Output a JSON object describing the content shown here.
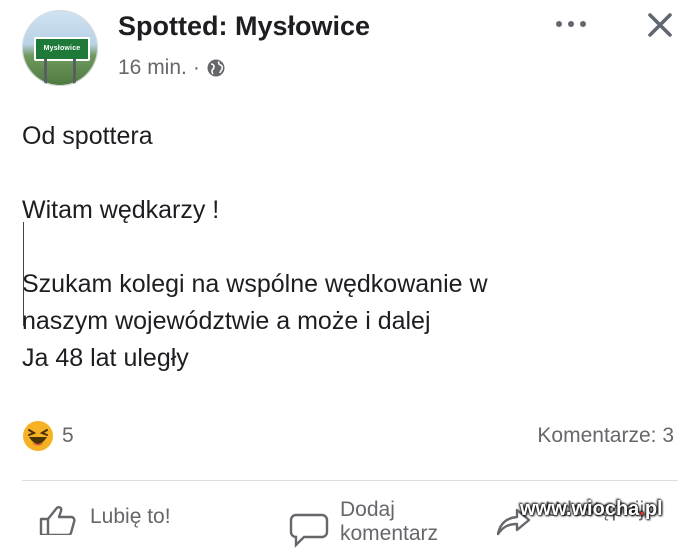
{
  "post": {
    "page_name": "Spotted: Mysłowice",
    "avatar_sign_text": "Mysłowice",
    "time": "16 min.",
    "separator": "·",
    "audience_icon": "globe-icon",
    "text": "Od spottera\n\nWitam wędkarzy !\n\nSzukam kolegi na wspólne wędkowanie w\nnaszym województwie a może i dalej\nJa 48 lat uległy"
  },
  "header_icons": {
    "more": "more-options-icon",
    "close": "close-icon"
  },
  "reactions": {
    "icon": "haha-reaction-icon",
    "count": "5"
  },
  "comments": {
    "label": "Komentarze: 3"
  },
  "actions": {
    "like": "Lubię to!",
    "comment_line1": "Dodaj",
    "comment_line2": "komentarz",
    "share": "Udostępnij"
  },
  "watermark": {
    "prefix": "www.wiocha",
    "dot": ".",
    "suffix": "pl"
  },
  "colors": {
    "text": "#1c1e21",
    "secondary": "#65676b",
    "reaction_yellow": "#f7b125"
  }
}
